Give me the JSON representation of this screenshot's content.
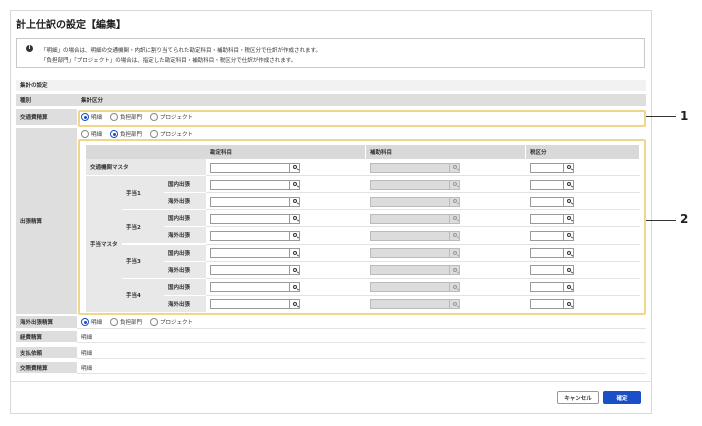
{
  "title": "計上仕訳の設定【編集】",
  "notice": {
    "line1": "「明細」の場合は、明細の交通機関・内訳に割り当てられた勘定科目・補助科目・税区分で仕訳が作成されます。",
    "line2": "「負担部門」「プロジェクト」の場合は、指定した勘定科目・補助科目・税区分で仕訳が作成されます。"
  },
  "section_label": "集計の設定",
  "header_row": {
    "left": "種別",
    "right": "集計区分"
  },
  "options": [
    "明細",
    "負担部門",
    "プロジェクト"
  ],
  "rows": {
    "transport": {
      "label": "交通費精算",
      "selected": 0
    },
    "business_trip": {
      "label": "出張精算",
      "selected": 1
    },
    "overseas": {
      "label": "海外出張精算",
      "selected": 0
    },
    "expense": {
      "label": "経費精算",
      "value": "明細"
    },
    "payment": {
      "label": "支払依頼",
      "value": "明細"
    },
    "entertainment": {
      "label": "交際費精算",
      "value": "明細"
    }
  },
  "grid": {
    "headers": [
      "勘定科目",
      "補助科目",
      "税区分"
    ],
    "transport_master": "交通機関マスタ",
    "allowance_master": "手当マスタ",
    "allowances": [
      "手当1",
      "手当2",
      "手当3",
      "手当4"
    ],
    "trip_types": [
      "国内出張",
      "海外出張"
    ]
  },
  "callouts": [
    "1",
    "2"
  ],
  "buttons": {
    "cancel": "キャンセル",
    "confirm": "確定"
  }
}
